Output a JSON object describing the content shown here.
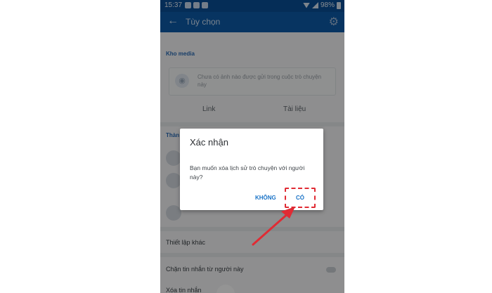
{
  "status_bar": {
    "time": "15:37",
    "battery": "98%"
  },
  "header": {
    "back_icon": "arrow-left-icon",
    "title": "Tùy chọn",
    "settings_icon": "gear-icon"
  },
  "media_section": {
    "label": "Kho media",
    "empty_message": "Chưa có ảnh nào được gửi trong cuộc trò chuyện này",
    "tabs": [
      "Link",
      "Tài liệu"
    ]
  },
  "members_section": {
    "label": "Thàn"
  },
  "other_settings": {
    "label": "Thiết lập khác",
    "block_messages": "Chặn tin nhắn từ người này",
    "delete_messages": "Xóa tin nhắn"
  },
  "dialog": {
    "title": "Xác nhận",
    "message": "Bạn muốn xóa lịch sử trò chuyện với người này?",
    "no_label": "KHÔNG",
    "yes_label": "CÓ"
  },
  "colors": {
    "accent": "#1a73c7",
    "highlight": "#e02b34",
    "header": "#0d5aa8"
  }
}
